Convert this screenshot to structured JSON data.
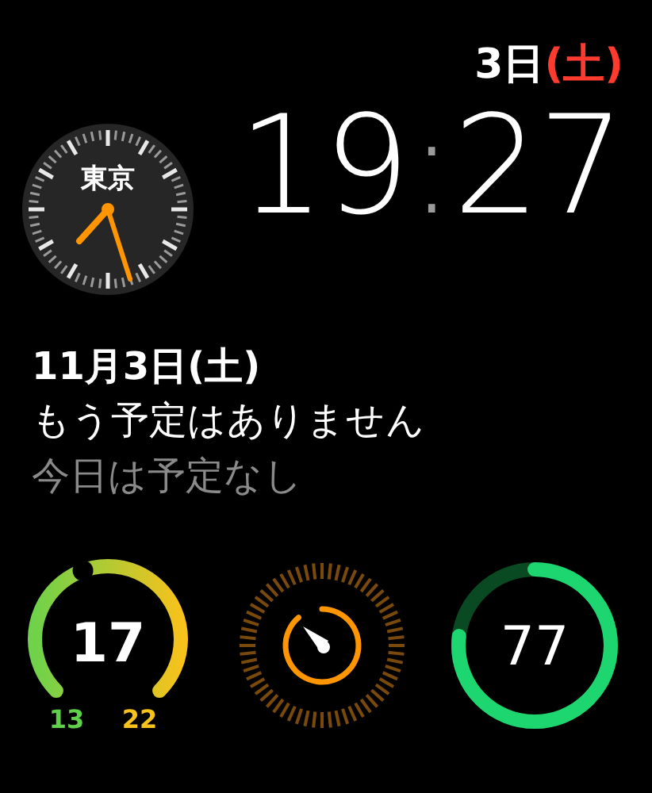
{
  "header": {
    "day": "3日",
    "weekday": "(土)"
  },
  "world_clock": {
    "city": "東京"
  },
  "time": {
    "hours": "19",
    "separator": ":",
    "minutes": "27"
  },
  "calendar": {
    "date": "11月3日(土)",
    "lines": [
      "もう予定はありません",
      "今日は予定なし"
    ]
  },
  "complications": [
    {
      "kind": "temperature",
      "value": "17",
      "low": "13",
      "high": "22"
    },
    {
      "kind": "timer"
    },
    {
      "kind": "battery",
      "value": "77"
    }
  ]
}
